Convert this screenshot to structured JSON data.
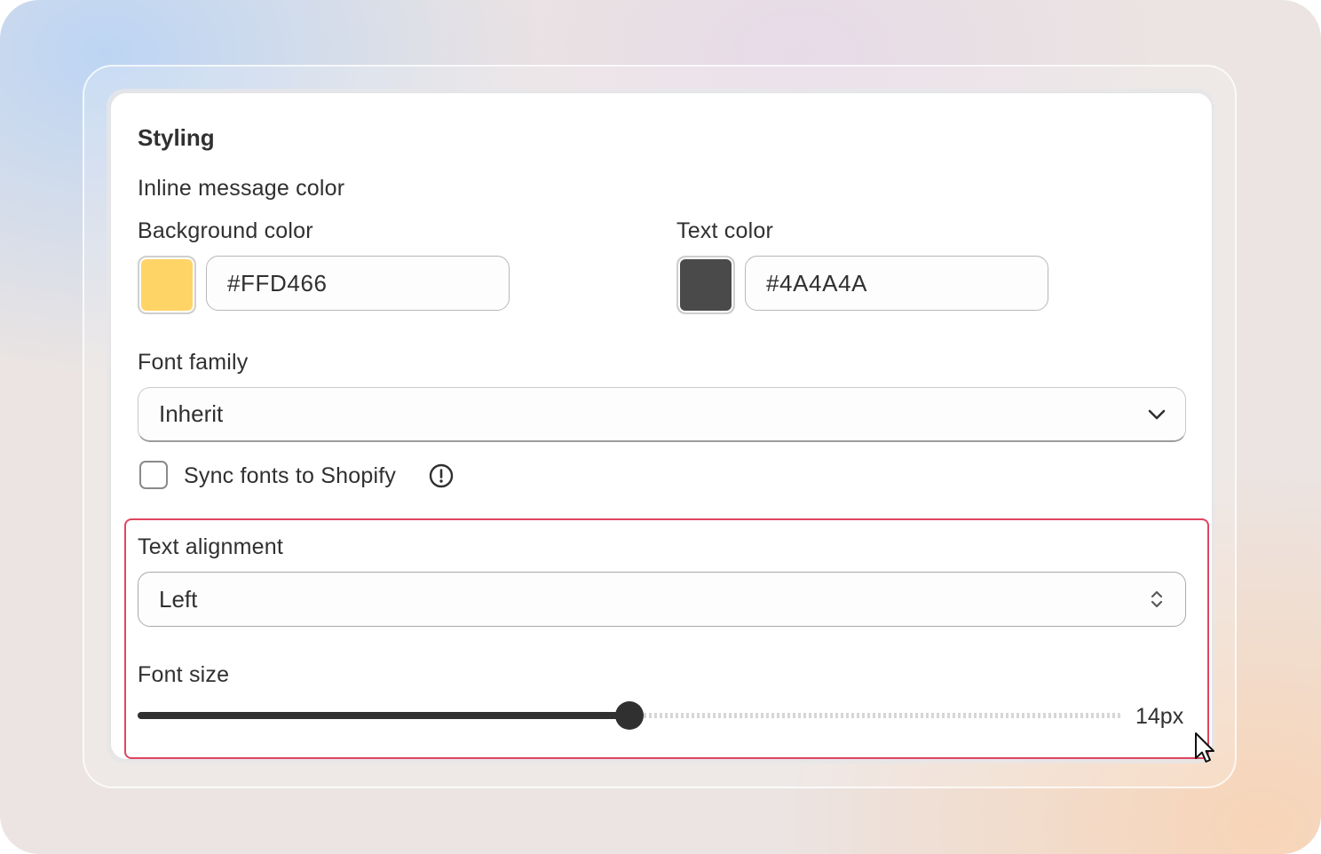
{
  "section": {
    "title": "Styling",
    "subtitle": "Inline message color"
  },
  "background_color": {
    "label": "Background color",
    "value": "#FFD466",
    "swatch": "#FFD466"
  },
  "text_color": {
    "label": "Text color",
    "value": "#4A4A4A",
    "swatch": "#4A4A4A"
  },
  "font_family": {
    "label": "Font family",
    "selected": "Inherit",
    "icon": "chevron-down-icon"
  },
  "sync_fonts": {
    "label": "Sync fonts to Shopify",
    "checked": false,
    "icon": "info-icon"
  },
  "text_alignment": {
    "label": "Text alignment",
    "selected": "Left",
    "icon": "chevron-up-down-icon"
  },
  "font_size": {
    "label": "Font size",
    "value_text": "14px",
    "fraction": 0.5
  },
  "colors": {
    "highlight": "#E0455F",
    "text": "#303030"
  }
}
